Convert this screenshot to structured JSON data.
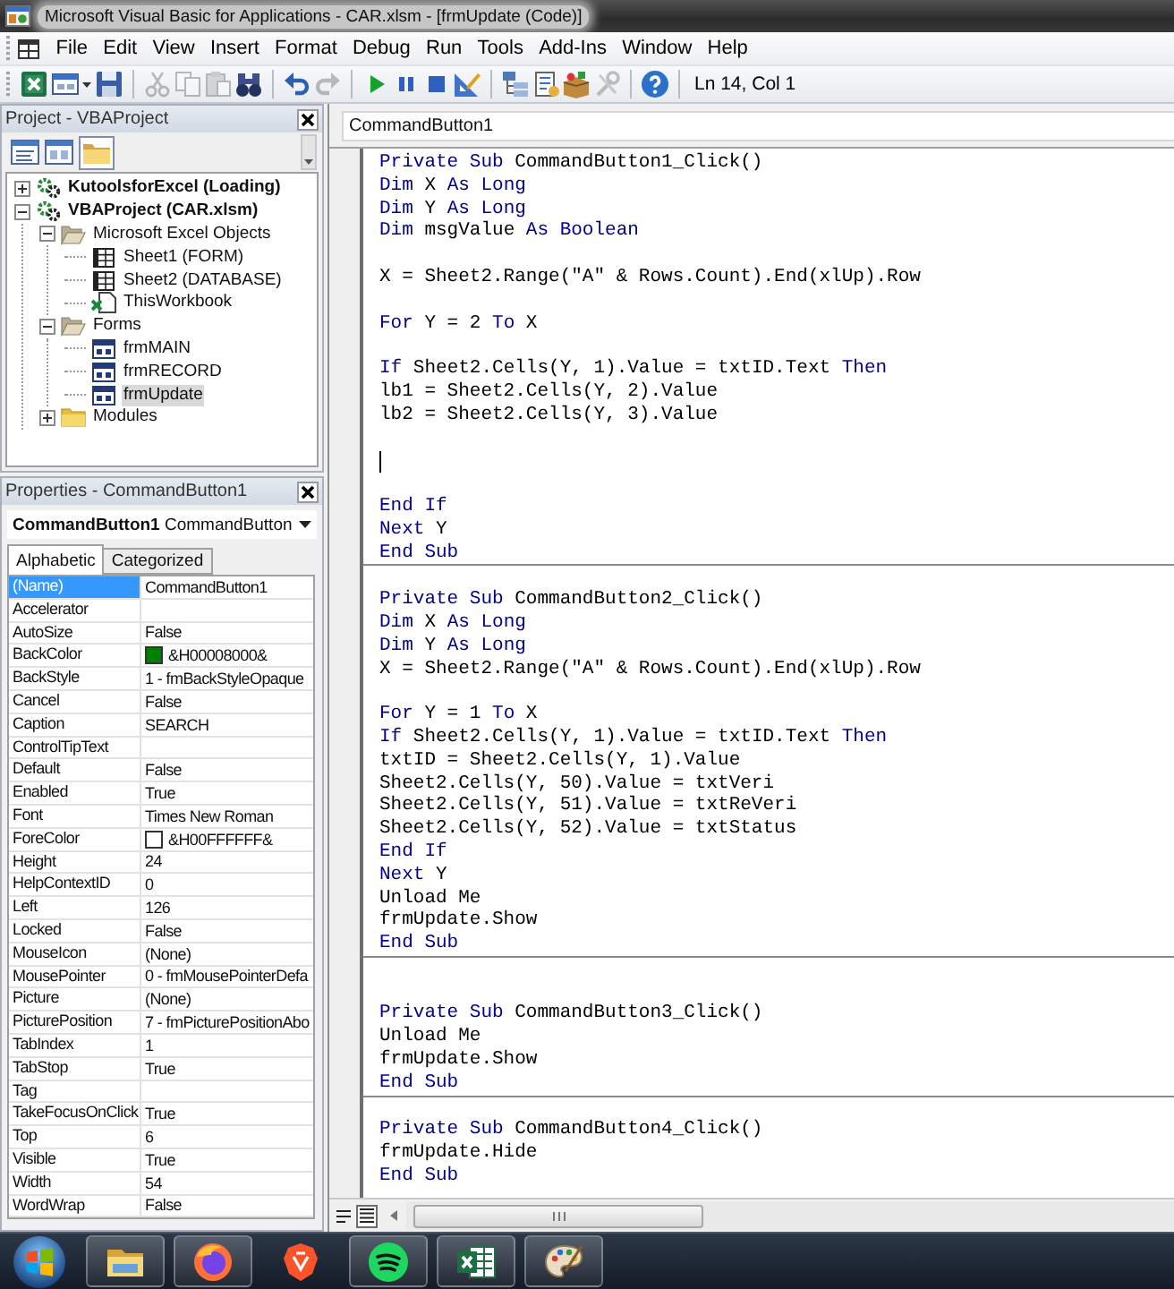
{
  "window": {
    "title": "Microsoft Visual Basic for Applications - CAR.xlsm - [frmUpdate (Code)]"
  },
  "menu": [
    "File",
    "Edit",
    "View",
    "Insert",
    "Format",
    "Debug",
    "Run",
    "Tools",
    "Add-Ins",
    "Window",
    "Help"
  ],
  "toolbar": {
    "groups": [
      {
        "buttons": [
          {
            "disabled": false
          },
          {
            "disabled": false
          },
          {
            "disabled": false
          }
        ]
      },
      {
        "buttons": [
          {
            "disabled": true
          },
          {
            "disabled": true
          },
          {
            "disabled": true
          },
          {
            "disabled": false
          }
        ]
      },
      {
        "buttons": [
          {
            "disabled": false
          },
          {
            "disabled": true
          }
        ]
      },
      {
        "buttons": [
          {
            "disabled": false
          },
          {
            "disabled": false
          },
          {
            "disabled": false
          },
          {
            "disabled": false
          }
        ]
      },
      {
        "buttons": [
          {
            "disabled": false
          },
          {
            "disabled": false
          },
          {
            "disabled": false
          },
          {
            "disabled": true
          }
        ]
      },
      {
        "buttons": [
          {
            "disabled": false
          }
        ]
      }
    ],
    "position": "Ln 14, Col 1"
  },
  "project": {
    "title": "Project - VBAProject",
    "folders_on": true,
    "tree": [
      {
        "label": "KutoolsforExcel (Loading)",
        "kind": "project",
        "expanded": false,
        "selected": false
      },
      {
        "label": "VBAProject (CAR.xlsm)",
        "kind": "project",
        "expanded": true,
        "selected": false,
        "children": [
          {
            "label": "Microsoft Excel Objects",
            "kind": "folder",
            "expanded": true,
            "selected": false,
            "children": [
              {
                "label": "Sheet1 (FORM)",
                "kind": "sheet",
                "selected": false
              },
              {
                "label": "Sheet2 (DATABASE)",
                "kind": "sheet",
                "selected": false
              },
              {
                "label": "ThisWorkbook",
                "kind": "workbook",
                "selected": false
              }
            ]
          },
          {
            "label": "Forms",
            "kind": "folder",
            "expanded": true,
            "selected": false,
            "children": [
              {
                "label": "frmMAIN",
                "kind": "form",
                "selected": false
              },
              {
                "label": "frmRECORD",
                "kind": "form",
                "selected": false
              },
              {
                "label": "frmUpdate",
                "kind": "form",
                "selected": true
              }
            ]
          },
          {
            "label": "Modules",
            "kind": "folder",
            "expanded": false,
            "selected": false
          }
        ]
      }
    ]
  },
  "properties": {
    "title": "Properties - CommandButton1",
    "object": "**CommandButton1** CommandButton",
    "tabs": [
      {
        "label": "Alphabetic",
        "selected": true
      },
      {
        "label": "Categorized",
        "selected": false
      }
    ],
    "rows": [
      {
        "name": "(Name)",
        "value": "CommandButton1",
        "selected": true
      },
      {
        "name": "Accelerator",
        "selected": false
      },
      {
        "name": "AutoSize",
        "value": "False",
        "selected": false
      },
      {
        "name": "BackColor",
        "value": "&H00008000&",
        "color": "#008000",
        "selected": false
      },
      {
        "name": "BackStyle",
        "value": "1 - fmBackStyleOpaque",
        "selected": false
      },
      {
        "name": "Cancel",
        "value": "False",
        "selected": false
      },
      {
        "name": "Caption",
        "value": "SEARCH",
        "selected": false
      },
      {
        "name": "ControlTipText",
        "selected": false
      },
      {
        "name": "Default",
        "value": "False",
        "selected": false
      },
      {
        "name": "Enabled",
        "value": "True",
        "selected": false
      },
      {
        "name": "Font",
        "value": "Times New Roman",
        "selected": false
      },
      {
        "name": "ForeColor",
        "value": "&H00FFFFFF&",
        "color": "#ffffff",
        "selected": false
      },
      {
        "name": "Height",
        "value": "24",
        "selected": false
      },
      {
        "name": "HelpContextID",
        "value": "0",
        "selected": false
      },
      {
        "name": "Left",
        "value": "126",
        "selected": false
      },
      {
        "name": "Locked",
        "value": "False",
        "selected": false
      },
      {
        "name": "MouseIcon",
        "value": "(None)",
        "selected": false
      },
      {
        "name": "MousePointer",
        "value": "0 - fmMousePointerDefa",
        "selected": false
      },
      {
        "name": "Picture",
        "value": "(None)",
        "selected": false
      },
      {
        "name": "PicturePosition",
        "value": "7 - fmPicturePositionAbo",
        "selected": false
      },
      {
        "name": "TabIndex",
        "value": "1",
        "selected": false
      },
      {
        "name": "TabStop",
        "value": "True",
        "selected": false
      },
      {
        "name": "Tag",
        "selected": false
      },
      {
        "name": "TakeFocusOnClick",
        "value": "True",
        "selected": false
      },
      {
        "name": "Top",
        "value": "6",
        "selected": false
      },
      {
        "name": "Visible",
        "value": "True",
        "selected": false
      },
      {
        "name": "Width",
        "value": "54",
        "selected": false
      },
      {
        "name": "WordWrap",
        "value": "False",
        "selected": false
      }
    ]
  },
  "code": {
    "object": "CommandButton1",
    "procedures": [
      {
        "lines": [
          {
            "kind": "code",
            "parts": [
              {
                "kind": "keyword",
                "text": "Private Sub"
              },
              {
                "kind": "plain",
                "text": " CommandButton1_Click()"
              }
            ]
          },
          {
            "kind": "code",
            "parts": [
              {
                "kind": "keyword",
                "text": "Dim"
              },
              {
                "kind": "plain",
                "text": " X "
              },
              {
                "kind": "keyword",
                "text": "As Long"
              }
            ]
          },
          {
            "kind": "code",
            "parts": [
              {
                "kind": "keyword",
                "text": "Dim"
              },
              {
                "kind": "plain",
                "text": " Y "
              },
              {
                "kind": "keyword",
                "text": "As Long"
              }
            ]
          },
          {
            "kind": "code",
            "parts": [
              {
                "kind": "keyword",
                "text": "Dim"
              },
              {
                "kind": "plain",
                "text": " msgValue "
              },
              {
                "kind": "keyword",
                "text": "As Boolean"
              }
            ]
          },
          {
            "kind": "blank"
          },
          {
            "kind": "code",
            "parts": [
              {
                "kind": "plain",
                "text": "X = Sheet2.Range(\"A\" & Rows.Count).End(xlUp).Row"
              }
            ]
          },
          {
            "kind": "blank"
          },
          {
            "kind": "code",
            "parts": [
              {
                "kind": "keyword",
                "text": "For"
              },
              {
                "kind": "plain",
                "text": " Y = 2 "
              },
              {
                "kind": "keyword",
                "text": "To"
              },
              {
                "kind": "plain",
                "text": " X"
              }
            ]
          },
          {
            "kind": "blank"
          },
          {
            "kind": "code",
            "parts": [
              {
                "kind": "keyword",
                "text": "If"
              },
              {
                "kind": "plain",
                "text": " Sheet2.Cells(Y, 1).Value = txtID.Text "
              },
              {
                "kind": "keyword",
                "text": "Then"
              }
            ]
          },
          {
            "kind": "code",
            "parts": [
              {
                "kind": "plain",
                "text": "lb1 = Sheet2.Cells(Y, 2).Value"
              }
            ]
          },
          {
            "kind": "code",
            "parts": [
              {
                "kind": "plain",
                "text": "lb2 = Sheet2.Cells(Y, 3).Value"
              }
            ]
          },
          {
            "kind": "blank"
          },
          {
            "kind": "caret"
          },
          {
            "kind": "blank"
          },
          {
            "kind": "code",
            "parts": [
              {
                "kind": "keyword",
                "text": "End If"
              }
            ]
          },
          {
            "kind": "code",
            "parts": [
              {
                "kind": "keyword",
                "text": "Next"
              },
              {
                "kind": "plain",
                "text": " Y"
              }
            ]
          },
          {
            "kind": "code",
            "parts": [
              {
                "kind": "keyword",
                "text": "End Sub"
              }
            ]
          }
        ]
      },
      {
        "lines": [
          {
            "kind": "blank"
          },
          {
            "kind": "code",
            "parts": [
              {
                "kind": "keyword",
                "text": "Private Sub"
              },
              {
                "kind": "plain",
                "text": " CommandButton2_Click()"
              }
            ]
          },
          {
            "kind": "code",
            "parts": [
              {
                "kind": "keyword",
                "text": "Dim"
              },
              {
                "kind": "plain",
                "text": " X "
              },
              {
                "kind": "keyword",
                "text": "As Long"
              }
            ]
          },
          {
            "kind": "code",
            "parts": [
              {
                "kind": "keyword",
                "text": "Dim"
              },
              {
                "kind": "plain",
                "text": " Y "
              },
              {
                "kind": "keyword",
                "text": "As Long"
              }
            ]
          },
          {
            "kind": "code",
            "parts": [
              {
                "kind": "plain",
                "text": "X = Sheet2.Range(\"A\" & Rows.Count).End(xlUp).Row"
              }
            ]
          },
          {
            "kind": "blank"
          },
          {
            "kind": "code",
            "parts": [
              {
                "kind": "keyword",
                "text": "For"
              },
              {
                "kind": "plain",
                "text": " Y = 1 "
              },
              {
                "kind": "keyword",
                "text": "To"
              },
              {
                "kind": "plain",
                "text": " X"
              }
            ]
          },
          {
            "kind": "code",
            "parts": [
              {
                "kind": "keyword",
                "text": "If"
              },
              {
                "kind": "plain",
                "text": " Sheet2.Cells(Y, 1).Value = txtID.Text "
              },
              {
                "kind": "keyword",
                "text": "Then"
              }
            ]
          },
          {
            "kind": "code",
            "parts": [
              {
                "kind": "plain",
                "text": "txtID = Sheet2.Cells(Y, 1).Value"
              }
            ]
          },
          {
            "kind": "code",
            "parts": [
              {
                "kind": "plain",
                "text": "Sheet2.Cells(Y, 50).Value = txtVeri"
              }
            ]
          },
          {
            "kind": "code",
            "parts": [
              {
                "kind": "plain",
                "text": "Sheet2.Cells(Y, 51).Value = txtReVeri"
              }
            ]
          },
          {
            "kind": "code",
            "parts": [
              {
                "kind": "plain",
                "text": "Sheet2.Cells(Y, 52).Value = txtStatus"
              }
            ]
          },
          {
            "kind": "code",
            "parts": [
              {
                "kind": "keyword",
                "text": "End If"
              }
            ]
          },
          {
            "kind": "code",
            "parts": [
              {
                "kind": "keyword",
                "text": "Next"
              },
              {
                "kind": "plain",
                "text": " Y"
              }
            ]
          },
          {
            "kind": "code",
            "parts": [
              {
                "kind": "plain",
                "text": "Unload Me"
              }
            ]
          },
          {
            "kind": "code",
            "parts": [
              {
                "kind": "plain",
                "text": "frmUpdate.Show"
              }
            ]
          },
          {
            "kind": "code",
            "parts": [
              {
                "kind": "keyword",
                "text": "End Sub"
              }
            ]
          }
        ]
      },
      {
        "lines": [
          {
            "kind": "blank"
          },
          {
            "kind": "blank"
          },
          {
            "kind": "code",
            "parts": [
              {
                "kind": "keyword",
                "text": "Private Sub"
              },
              {
                "kind": "plain",
                "text": " CommandButton3_Click()"
              }
            ]
          },
          {
            "kind": "code",
            "parts": [
              {
                "kind": "plain",
                "text": "Unload Me"
              }
            ]
          },
          {
            "kind": "code",
            "parts": [
              {
                "kind": "plain",
                "text": "frmUpdate.Show"
              }
            ]
          },
          {
            "kind": "code",
            "parts": [
              {
                "kind": "keyword",
                "text": "End Sub"
              }
            ]
          }
        ]
      },
      {
        "lines": [
          {
            "kind": "blank"
          },
          {
            "kind": "code",
            "parts": [
              {
                "kind": "keyword",
                "text": "Private Sub"
              },
              {
                "kind": "plain",
                "text": " CommandButton4_Click()"
              }
            ]
          },
          {
            "kind": "code",
            "parts": [
              {
                "kind": "plain",
                "text": "frmUpdate.Hide"
              }
            ]
          },
          {
            "kind": "code",
            "parts": [
              {
                "kind": "keyword",
                "text": "End Sub"
              }
            ]
          }
        ]
      }
    ],
    "view_buttons": [
      {
        "selected": false
      },
      {
        "selected": true
      }
    ]
  },
  "taskbar": {
    "apps": [
      {
        "running": true
      },
      {
        "running": true
      },
      {
        "running": false
      },
      {
        "running": true
      },
      {
        "running": true
      },
      {
        "running": true
      }
    ]
  }
}
